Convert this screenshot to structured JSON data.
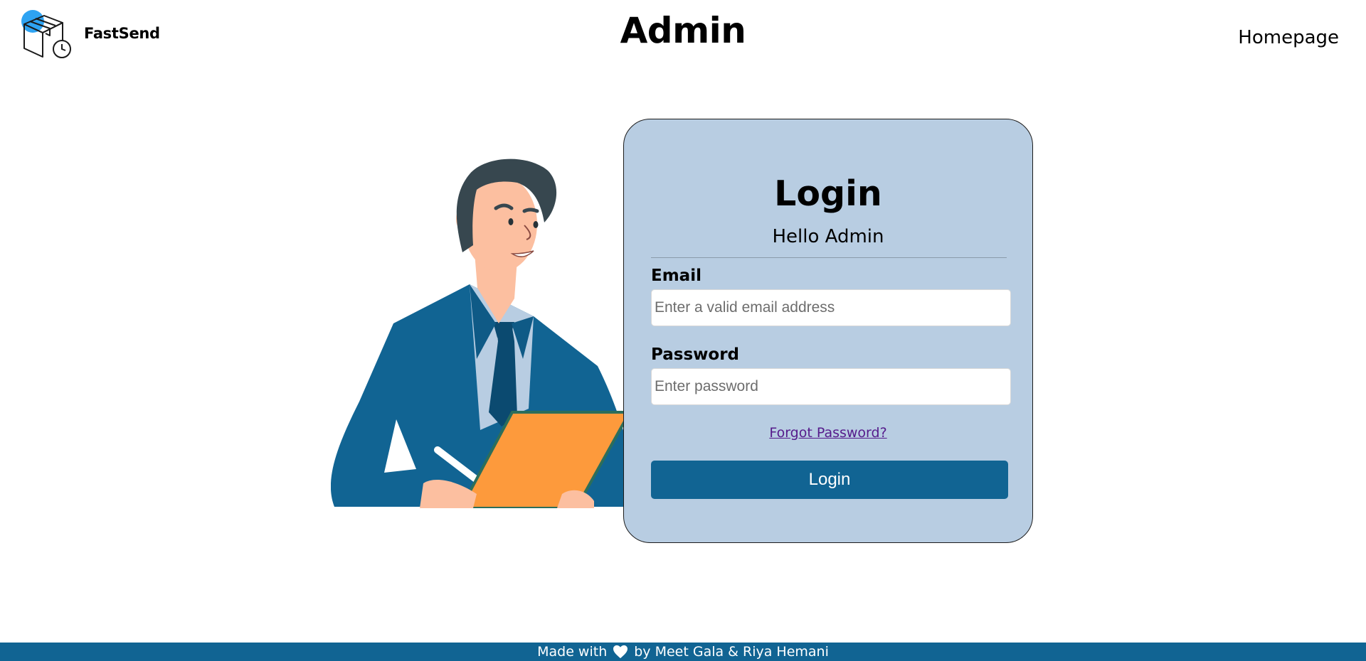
{
  "header": {
    "brand_name": "FastSend",
    "page_title": "Admin",
    "nav_home": "Homepage"
  },
  "login": {
    "title": "Login",
    "subtitle": "Hello Admin",
    "email_label": "Email",
    "email_placeholder": "Enter a valid email address",
    "email_value": "",
    "password_label": "Password",
    "password_placeholder": "Enter password",
    "password_value": "",
    "forgot_link": "Forgot Password?",
    "submit_label": "Login"
  },
  "footer": {
    "prefix": "Made with",
    "suffix": "by Meet Gala & Riya Hemani",
    "icon": "heart-icon"
  },
  "colors": {
    "primary": "#116493",
    "card_background": "#b8cde2",
    "logo_accent": "#2ea3f2",
    "clipboard": "#fd9a3c",
    "link": "#551a8b"
  },
  "icons": {
    "logo": "package-clock-icon",
    "illustration": "businessman-with-clipboard"
  }
}
